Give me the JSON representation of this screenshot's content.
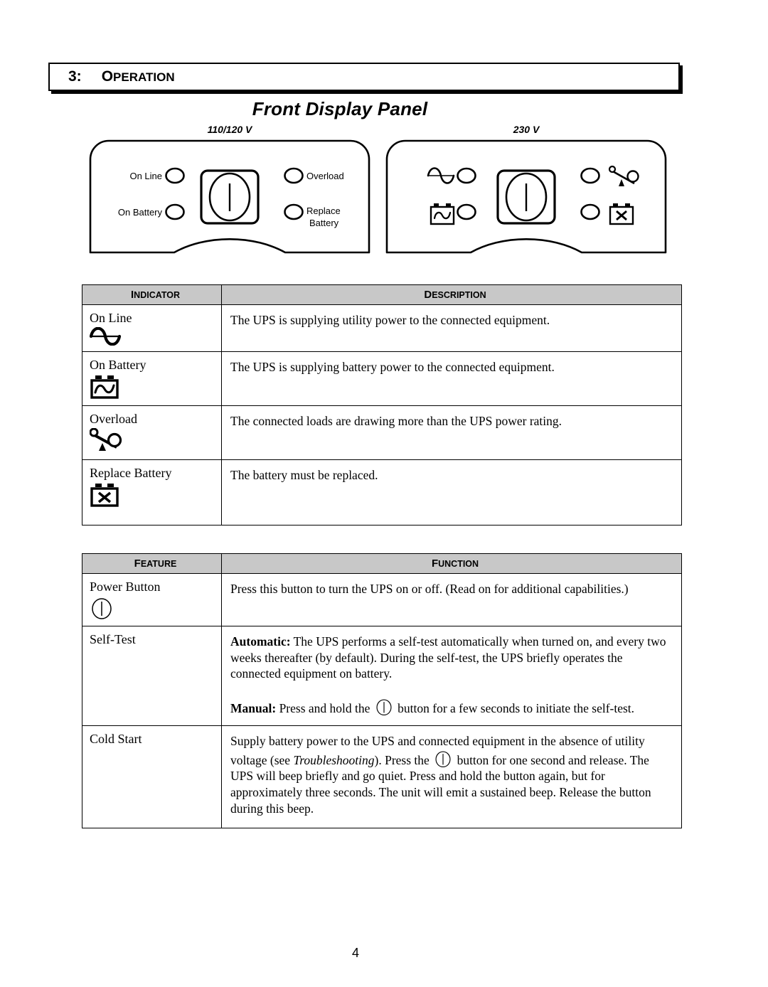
{
  "chapter": {
    "number": "3:",
    "title": "Operation"
  },
  "section_title": "Front Display Panel",
  "panels": {
    "left": {
      "caption": "110/120 V",
      "leds": [
        {
          "label": "On Line",
          "side": "left"
        },
        {
          "label": "On Battery",
          "side": "left"
        },
        {
          "label": "Overload",
          "side": "right"
        },
        {
          "label": "Replace Battery",
          "side": "right"
        }
      ],
      "power_button": "power-button-symbol"
    },
    "right": {
      "caption": "230 V",
      "leds": [
        {
          "icon": "sine-wave-icon",
          "side": "left"
        },
        {
          "icon": "battery-sine-icon",
          "side": "left"
        },
        {
          "icon": "overload-scale-icon",
          "side": "right"
        },
        {
          "icon": "battery-x-icon",
          "side": "right"
        }
      ],
      "power_button": "power-button-symbol"
    }
  },
  "indicator_table": {
    "headers": [
      "Indicator",
      "Description"
    ],
    "rows": [
      {
        "label": "On Line",
        "icon": "sine-wave-icon",
        "description": "The UPS is supplying utility power to the connected equipment."
      },
      {
        "label": "On Battery",
        "icon": "battery-sine-icon",
        "description": "The UPS is supplying battery power to the connected equipment."
      },
      {
        "label": "Overload",
        "icon": "overload-scale-icon",
        "description": "The connected loads are drawing more than the UPS power rating."
      },
      {
        "label": "Replace Battery",
        "icon": "battery-x-icon",
        "description": "The battery must be replaced."
      }
    ]
  },
  "feature_table": {
    "headers": [
      "Feature",
      "Function"
    ],
    "rows": [
      {
        "label": "Power Button",
        "icon": "power-button-symbol",
        "description": "Press this button to turn the UPS on or off. (Read on for additional capabilities.)"
      },
      {
        "label": "Self-Test",
        "icon": "",
        "automatic_bold": "Automatic:",
        "automatic_text": " The UPS performs a self-test automatically when turned on, and every two weeks thereafter (by default). During the self-test, the UPS briefly operates the connected equipment on battery.",
        "manual_bold": "Manual:",
        "manual_text_before": " Press and hold the ",
        "manual_text_after": " button for a few seconds to initiate the self-test."
      },
      {
        "label": "Cold Start",
        "icon": "",
        "cold_text_1": "Supply battery power to the UPS and connected equipment in the absence of utility voltage (see ",
        "cold_italic": "Troubleshooting",
        "cold_text_2": "). Press the ",
        "cold_text_3": " button for one second and release. The UPS will beep briefly and go quiet. Press and hold the button again, but for approximately three seconds. The unit will emit a sustained beep. Release the button during this beep."
      }
    ]
  },
  "page_number": "4",
  "colors": {
    "header_fill": "#c8c8c8",
    "ink": "#000000",
    "paper": "#ffffff"
  }
}
